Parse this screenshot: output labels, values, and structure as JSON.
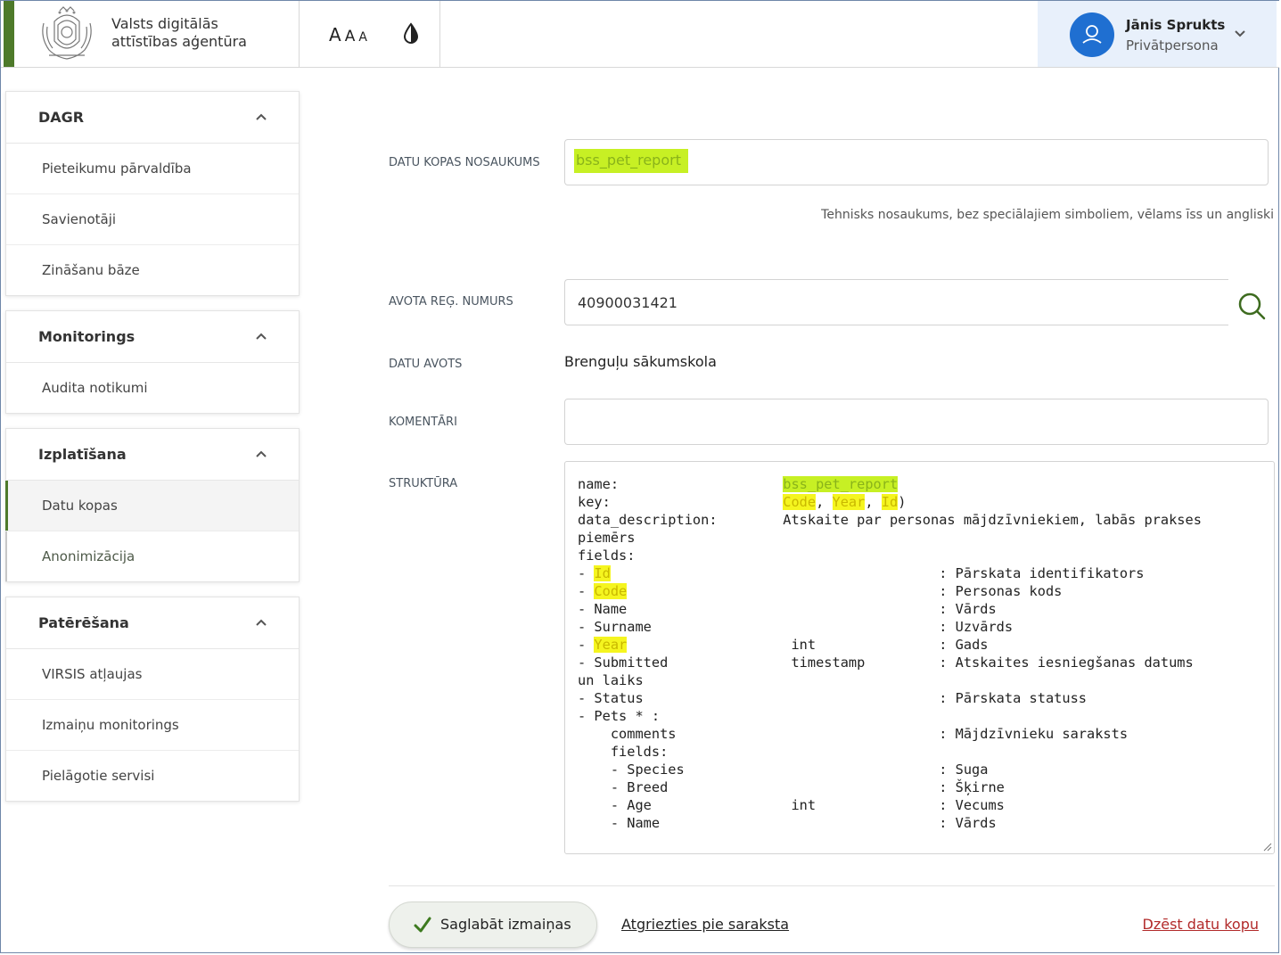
{
  "header": {
    "org_line1": "Valsts digitālās",
    "org_line2": "attīstības aģentūra",
    "font_sizes": [
      "A",
      "A",
      "A"
    ],
    "user_name": "Jānis Sprukts",
    "user_role": "Privātpersona"
  },
  "sidebar": [
    {
      "title": "DAGR",
      "items": [
        "Pieteikumu pārvaldība",
        "Savienotāji",
        "Zināšanu bāze"
      ]
    },
    {
      "title": "Monitorings",
      "items": [
        "Audita notikumi"
      ]
    },
    {
      "title": "Izplatīšana",
      "items": [
        "Datu kopas",
        "Anonimizācija"
      ]
    },
    {
      "title": "Patērēšana",
      "items": [
        "VIRSIS atļaujas",
        "Izmaiņu monitorings",
        "Pielāgotie servisi"
      ]
    }
  ],
  "form": {
    "name_label": "DATU KOPAS NOSAUKUMS",
    "name_value": "bss_pet_report",
    "name_hint": "Tehnisks nosaukums, bez speciālajiem simboliem, vēlams īss un angliski",
    "reg_label": "AVOTA REĢ. NUMURS",
    "reg_value": "40900031421",
    "source_label": "DATU AVOTS",
    "source_value": "Brenguļu sākumskola",
    "comment_label": "KOMENTĀRI",
    "comment_value": "",
    "structure_label": "STRUKTŪRA",
    "structure_lines": [
      "name:                    bss_pet_report",
      "key:                     Code, Year, Id)",
      "data_description:        Atskaite par personas mājdzīvniekiem, labās prakses",
      "piemērs",
      "fields:",
      "- Id                                        : Pārskata identifikators",
      "- Code                                      : Personas kods",
      "- Name                                      : Vārds",
      "- Surname                                   : Uzvārds",
      "- Year                    int               : Gads",
      "- Submitted               timestamp         : Atskaites iesniegšanas datums",
      "un laiks",
      "- Status                                    : Pārskata statuss",
      "- Pets * :",
      "    comments                                : Mājdzīvnieku saraksts",
      "    fields:",
      "    - Species                               : Suga",
      "    - Breed                                 : Šķirne",
      "    - Age                 int               : Vecums",
      "    - Name                                  : Vārds"
    ]
  },
  "actions": {
    "save": "Saglabāt izmaiņas",
    "back": "Atgriezties pie saraksta",
    "delete": "Dzēst datu kopu"
  },
  "colors": {
    "brand_green": "#4e7a2a",
    "highlight_green": "#c7f024",
    "highlight_yellow": "#f5f51f",
    "avatar_blue": "#1f6fd1",
    "delete_red": "#b22a2a"
  }
}
